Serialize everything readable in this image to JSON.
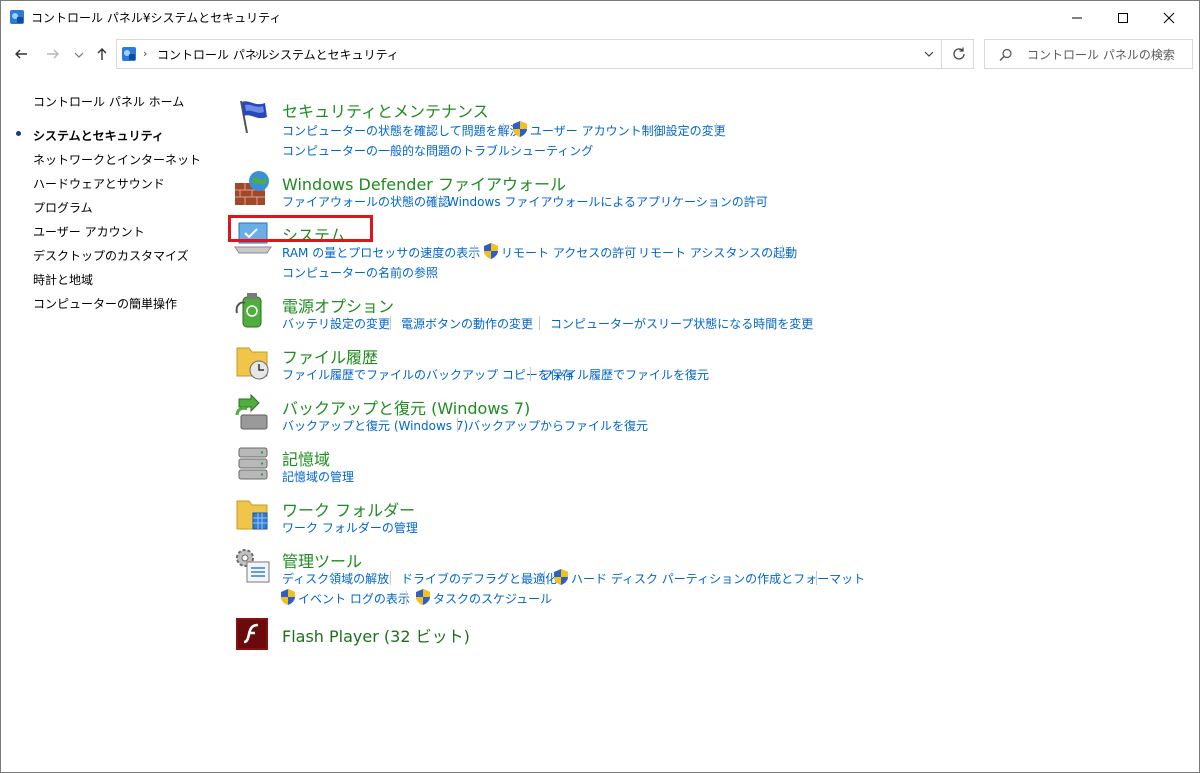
{
  "window": {
    "title": "コントロール パネル¥システムとセキュリティ"
  },
  "breadcrumb": [
    "コントロール パネル",
    "システムとセキュリティ"
  ],
  "search": {
    "placeholder": "コントロール パネルの検索"
  },
  "sidebar": {
    "items": [
      {
        "label": "コントロール パネル ホーム",
        "current": false
      },
      {
        "label": "システムとセキュリティ",
        "current": true
      },
      {
        "label": "ネットワークとインターネット",
        "current": false
      },
      {
        "label": "ハードウェアとサウンド",
        "current": false
      },
      {
        "label": "プログラム",
        "current": false
      },
      {
        "label": "ユーザー アカウント",
        "current": false
      },
      {
        "label": "デスクトップのカスタマイズ",
        "current": false
      },
      {
        "label": "時計と地域",
        "current": false
      },
      {
        "label": "コンピューターの簡単操作",
        "current": false
      }
    ]
  },
  "categories": [
    {
      "title": "セキュリティとメンテナンス",
      "icon": "flag-icon",
      "tasks": [
        "コンピューターの状態を確認して問題を解決",
        "ユーザー アカウント制御設定の変更",
        "コンピューターの一般的な問題のトラブルシューティング"
      ]
    },
    {
      "title": "Windows Defender ファイアウォール",
      "icon": "firewall-icon",
      "tasks": [
        "ファイアウォールの状態の確認",
        "Windows ファイアウォールによるアプリケーションの許可"
      ]
    },
    {
      "title": "システム",
      "icon": "system-icon",
      "tasks": [
        "RAM の量とプロセッサの速度の表示",
        "リモート アクセスの許可",
        "リモート アシスタンスの起動",
        "コンピューターの名前の参照"
      ]
    },
    {
      "title": "電源オプション",
      "icon": "power-options-icon",
      "tasks": [
        "バッテリ設定の変更",
        "電源ボタンの動作の変更",
        "コンピューターがスリープ状態になる時間を変更"
      ]
    },
    {
      "title": "ファイル履歴",
      "icon": "file-history-icon",
      "tasks": [
        "ファイル履歴でファイルのバックアップ コピーを保存",
        "ファイル履歴でファイルを復元"
      ]
    },
    {
      "title": "バックアップと復元 (Windows 7)",
      "icon": "backup-restore-icon",
      "tasks": [
        "バックアップと復元 (Windows 7)",
        "バックアップからファイルを復元"
      ]
    },
    {
      "title": "記憶域",
      "icon": "storage-spaces-icon",
      "tasks": [
        "記憶域の管理"
      ]
    },
    {
      "title": "ワーク フォルダー",
      "icon": "work-folders-icon",
      "tasks": [
        "ワーク フォルダーの管理"
      ]
    },
    {
      "title": "管理ツール",
      "icon": "admin-tools-icon",
      "tasks": [
        "ディスク領域の解放",
        "ドライブのデフラグと最適化",
        "ハード ディスク パーティションの作成とフォーマット",
        "イベント ログの表示",
        "タスクのスケジュール"
      ]
    },
    {
      "title": "Flash Player (32 ビット)",
      "icon": "flash-player-icon",
      "tasks": []
    }
  ],
  "colors": {
    "category_title": "#1e8c1e",
    "task_link": "#0066cc",
    "highlight_box": "#e0141e"
  }
}
